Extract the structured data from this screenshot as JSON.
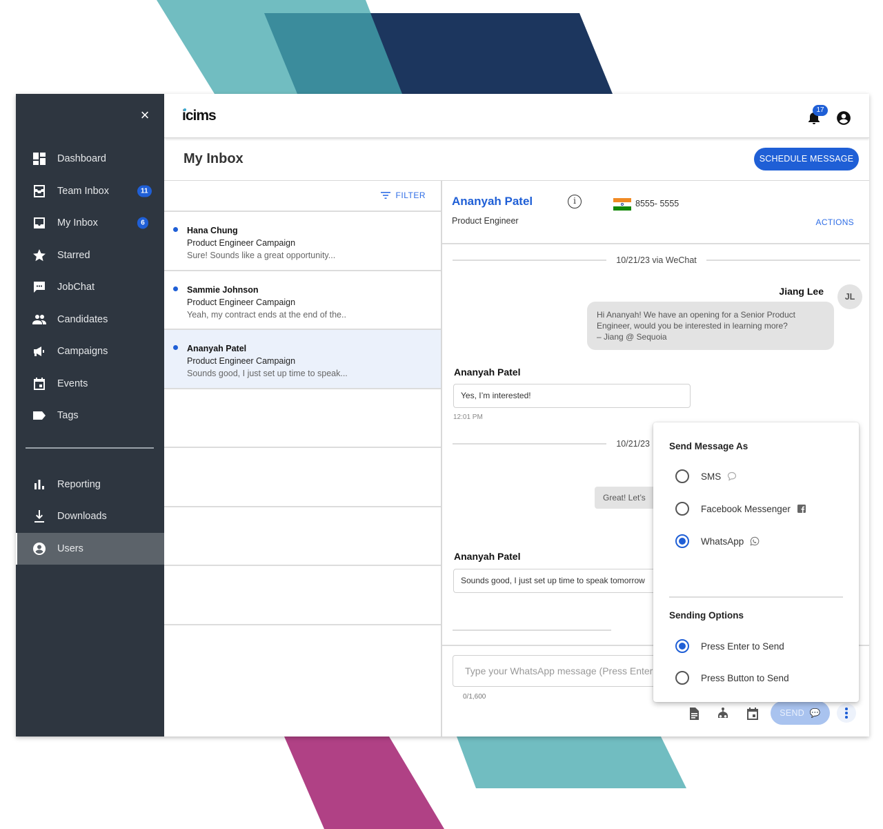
{
  "decor": {
    "colors": {
      "teal_light": "#71bdc1",
      "teal_mid": "#3b8c9c",
      "navy": "#1c365e",
      "magenta": "#b04185"
    }
  },
  "app": {
    "brand": "icims",
    "accent_color": "#1f5fd6",
    "notifications_count": "17"
  },
  "sidebar": {
    "close_label": "×",
    "items": [
      {
        "label": "Dashboard",
        "icon": "dashboard-icon"
      },
      {
        "label": "Team Inbox",
        "icon": "team-inbox-icon",
        "badge": "11"
      },
      {
        "label": "My Inbox",
        "icon": "inbox-icon",
        "badge": "6"
      },
      {
        "label": "Starred",
        "icon": "star-icon"
      },
      {
        "label": "JobChat",
        "icon": "chat-icon"
      },
      {
        "label": "Candidates",
        "icon": "people-icon"
      },
      {
        "label": "Campaigns",
        "icon": "megaphone-icon"
      },
      {
        "label": "Events",
        "icon": "calendar-icon"
      },
      {
        "label": "Tags",
        "icon": "tag-icon"
      }
    ],
    "secondary_items": [
      {
        "label": "Reporting",
        "icon": "bar-chart-icon"
      },
      {
        "label": "Downloads",
        "icon": "download-icon"
      },
      {
        "label": "Users",
        "icon": "user-circle-icon",
        "active": true
      }
    ]
  },
  "page": {
    "title": "My Inbox",
    "schedule_button": "SCHEDULE MESSAGE"
  },
  "conversations": {
    "filter_label": "FILTER",
    "items": [
      {
        "name": "Hana Chung",
        "campaign": "Product Engineer Campaign",
        "preview": "Sure! Sounds like a great opportunity...",
        "unread": true
      },
      {
        "name": "Sammie Johnson",
        "campaign": "Product Engineer Campaign",
        "preview": "Yeah, my contract ends at the end of the..",
        "unread": true
      },
      {
        "name": "Ananyah Patel",
        "campaign": "Product Engineer Campaign",
        "preview": "Sounds good, I just set up time to speak...",
        "unread": true,
        "selected": true
      }
    ]
  },
  "chat": {
    "contact": {
      "name": "Ananyah Patel",
      "role": "Product Engineer",
      "phone": "8555- 5555",
      "country_flag": "India"
    },
    "actions_label": "ACTIONS",
    "dividers": [
      "10/21/23 via WeChat",
      "10/21/23"
    ],
    "messages": [
      {
        "sender": "Jiang Lee",
        "initials": "JL",
        "text_lines": [
          "Hi Ananyah! We have an opening for a Senior Product",
          "Engineer, would you be interested in learning more?",
          " – Jiang @ Sequoia"
        ],
        "direction": "outgoing"
      },
      {
        "sender": "Ananyah Patel",
        "text": "Yes, I’m interested!",
        "time": "12:01 PM",
        "direction": "incoming"
      },
      {
        "text": "Great! Let’s",
        "direction": "outgoing"
      },
      {
        "sender": "Ananyah Patel",
        "text": "Sounds good, I just set up time to speak tomorrow",
        "direction": "incoming"
      }
    ],
    "composer": {
      "placeholder": "Type your WhatsApp message (Press Enter to Send)",
      "char_count": "0/1,600",
      "send_label": "SEND"
    }
  },
  "send_popover": {
    "title": "Send Message As",
    "channels": [
      {
        "label": "SMS",
        "icon": "sms-bubble-icon",
        "checked": false
      },
      {
        "label": "Facebook Messenger",
        "icon": "facebook-icon",
        "checked": false
      },
      {
        "label": "WhatsApp",
        "icon": "whatsapp-icon",
        "checked": true
      }
    ],
    "options_title": "Sending Options",
    "options": [
      {
        "label": "Press Enter to Send",
        "checked": true
      },
      {
        "label": "Press Button to Send",
        "checked": false
      }
    ]
  }
}
